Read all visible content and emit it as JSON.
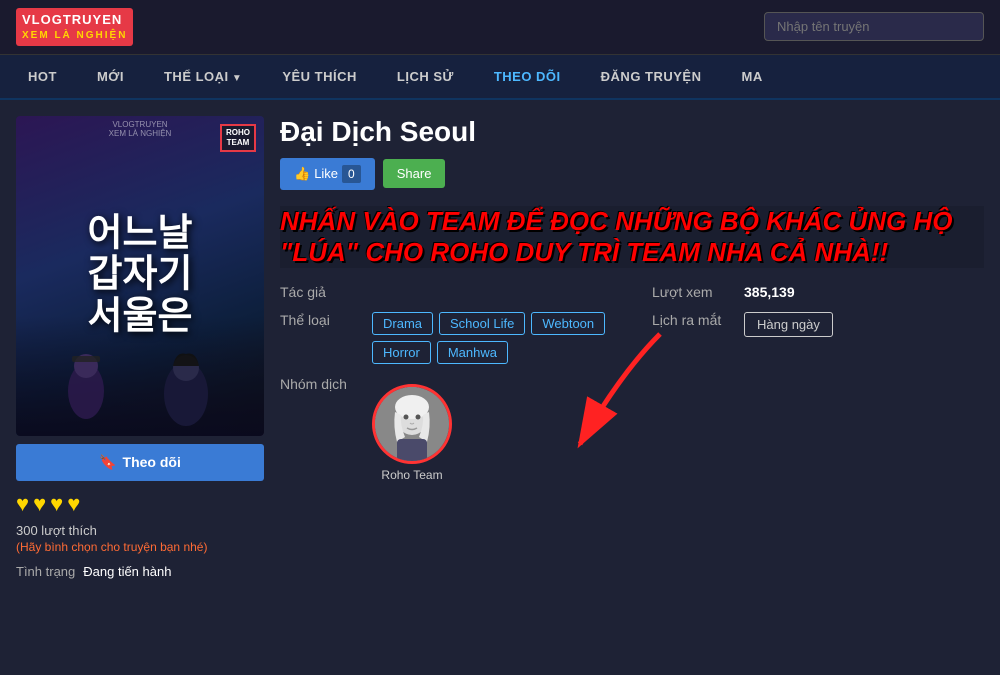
{
  "header": {
    "logo_line1": "VLOGTRUYEN",
    "logo_line2": "XEM LÀ NGHIỆN",
    "search_placeholder": "Nhập tên truyện"
  },
  "nav": {
    "items": [
      {
        "label": "HOT",
        "active": false
      },
      {
        "label": "MỚI",
        "active": false
      },
      {
        "label": "THỂ LOẠI",
        "active": false,
        "has_arrow": true
      },
      {
        "label": "YÊU THÍCH",
        "active": false
      },
      {
        "label": "LỊCH SỬ",
        "active": false
      },
      {
        "label": "THEO DÕI",
        "active": true
      },
      {
        "label": "ĐĂNG TRUYỆN",
        "active": false
      },
      {
        "label": "MA",
        "active": false
      }
    ]
  },
  "manga": {
    "title": "Đại Dịch Seoul",
    "cover_text": "어느날\n갑자기\n서울은",
    "like_label": "Like",
    "like_count": "0",
    "share_label": "Share",
    "promo_text": "NHẤN VÀO TEAM ĐỂ ĐỌC NHỮNG BỘ KHÁC ỦNG HỘ \"LÚA\" CHO ROHO DUY TRÌ TEAM NHA CẢ NHÀ!!",
    "author_label": "Tác giả",
    "author_value": "",
    "genre_label": "Thể loại",
    "genres": [
      {
        "label": "Drama"
      },
      {
        "label": "School Life"
      },
      {
        "label": "Webtoon"
      },
      {
        "label": "Horror"
      },
      {
        "label": "Manhwa"
      }
    ],
    "translator_label": "Nhóm dịch",
    "translator_name": "Roho Team",
    "views_label": "Lượt xem",
    "views_count": "385,139",
    "schedule_label": "Lịch ra mắt",
    "schedule_value": "Hàng ngày",
    "follow_label": "Theo dõi",
    "hearts": [
      "♥",
      "♥",
      "♥",
      "♥"
    ],
    "likes_text": "300 lượt thích",
    "vote_text": "(Hãy bình chọn cho truyện bạn nhé)",
    "status_label": "Tình trạng",
    "status_value": "Đang tiến hành",
    "roho_badge_line1": "ROHO",
    "roho_badge_line2": "TEAM"
  }
}
